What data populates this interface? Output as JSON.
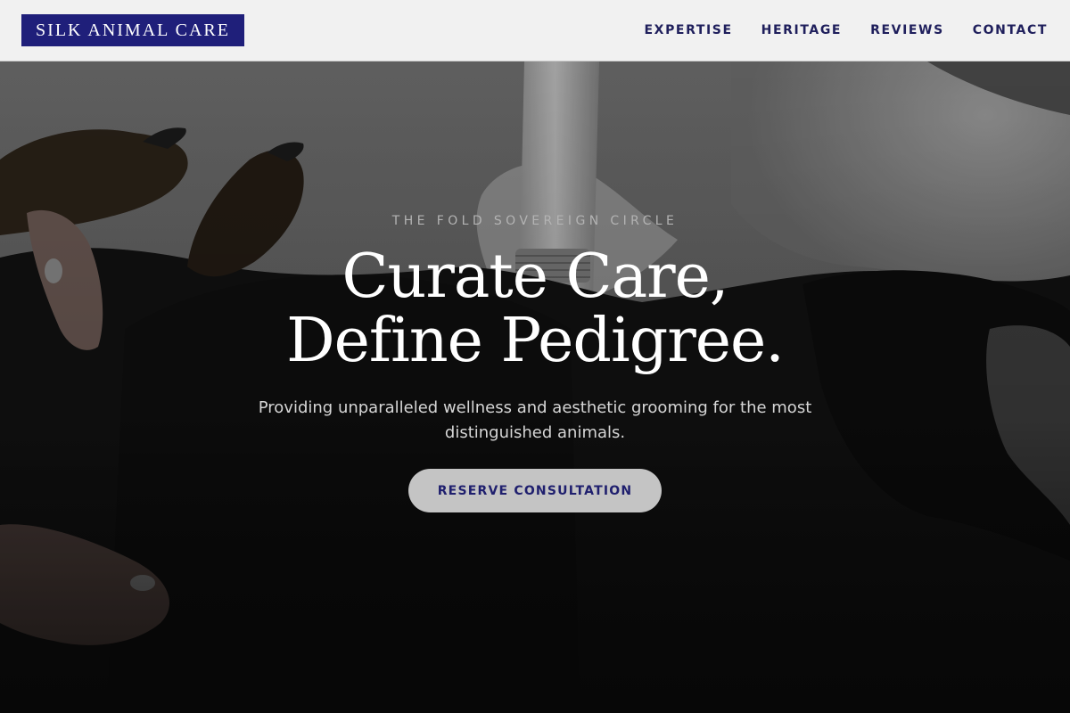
{
  "header": {
    "logo_text": "SILK ANIMAL CARE",
    "nav": [
      {
        "label": "EXPERTISE"
      },
      {
        "label": "HERITAGE"
      },
      {
        "label": "REVIEWS"
      },
      {
        "label": "CONTACT"
      }
    ]
  },
  "hero": {
    "eyebrow": "THE FOLD SOVEREIGN CIRCLE",
    "title_line_1": "Curate Care,",
    "title_line_2": "Define Pedigree.",
    "subtitle": "Providing unparalleled wellness and aesthetic grooming for the most distinguished animals.",
    "cta_label": "RESERVE CONSULTATION"
  },
  "colors": {
    "brand_navy": "#1f1f7a",
    "nav_text": "#1f1f5c",
    "header_bg": "#f1f1f1",
    "hero_overlay": "#0b0b0b",
    "cta_bg": "#c4c4c4"
  }
}
